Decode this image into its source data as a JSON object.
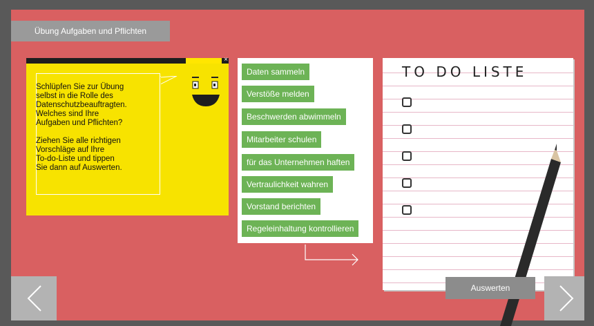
{
  "header": {
    "title": "Übung Aufgaben und Pflichten"
  },
  "instruction": {
    "close_symbol": "×",
    "text": "Schlüpfen Sie zur Übung\nselbst in die Rolle des\nDatenschutzbeauftragten.\nWelches sind Ihre\nAufgaben und Pflichten?\n\nZiehen Sie alle richtigen\nVorschläge auf Ihre\nTo-do-Liste und tippen\nSie dann auf Auswerten."
  },
  "options": [
    {
      "label": "Daten sammeln"
    },
    {
      "label": "Verstöße melden"
    },
    {
      "label": "Beschwerden abwimmeln"
    },
    {
      "label": "Mitarbeiter schulen"
    },
    {
      "label": "für das Unternehmen haften"
    },
    {
      "label": "Vertraulichkeit wahren"
    },
    {
      "label": "Vorstand berichten"
    },
    {
      "label": "Regeleinhaltung kontrollieren"
    }
  ],
  "todo": {
    "title": "TO DO LISTE",
    "checkbox_count": 5
  },
  "actions": {
    "evaluate_label": "Auswerten"
  },
  "colors": {
    "background": "#d96061",
    "note": "#f7e300",
    "chip": "#6db356"
  },
  "icons": {
    "prev": "chevron-left-icon",
    "next": "chevron-right-icon",
    "close": "close-icon",
    "arrow": "arrow-right-icon",
    "pencil": "pencil-icon",
    "face": "smiley-face-icon"
  }
}
